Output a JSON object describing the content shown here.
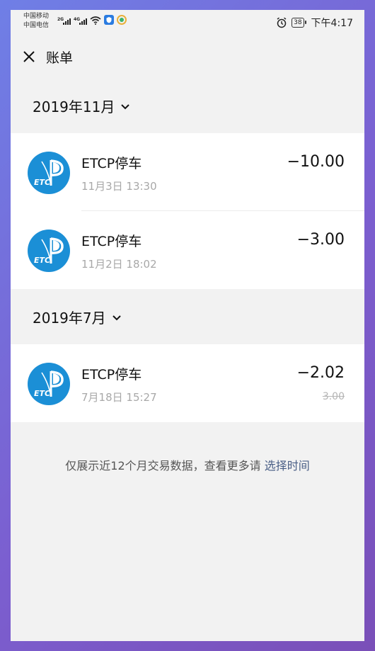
{
  "status_bar": {
    "carrier1": "中国移动",
    "carrier2": "中国电信",
    "net1": "2G",
    "net2": "4G",
    "battery": "38",
    "time": "下午4:17"
  },
  "header": {
    "title": "账单"
  },
  "sections": [
    {
      "month": "2019年11月",
      "items": [
        {
          "merchant": "ETCP停车",
          "time": "11月3日 13:30",
          "amount": "−10.00",
          "logo_text": "ETC"
        },
        {
          "merchant": "ETCP停车",
          "time": "11月2日 18:02",
          "amount": "−3.00",
          "logo_text": "ETC"
        }
      ]
    },
    {
      "month": "2019年7月",
      "items": [
        {
          "merchant": "ETCP停车",
          "time": "7月18日 15:27",
          "amount": "−2.02",
          "original_amount": "3.00",
          "logo_text": "ETC"
        }
      ]
    }
  ],
  "footer": {
    "note": "仅展示近12个月交易数据，查看更多请 ",
    "link": "选择时间"
  },
  "colors": {
    "logo_blue": "#1b8fd6",
    "link": "#4a5f86",
    "background": "#f2f2f2"
  }
}
